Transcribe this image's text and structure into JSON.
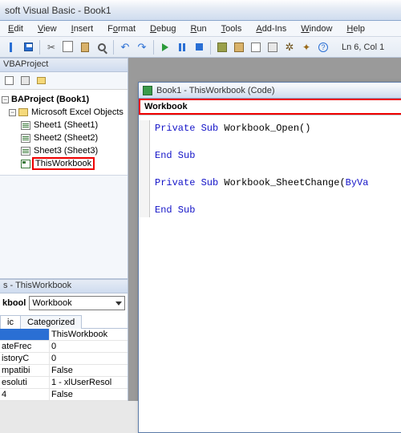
{
  "title": "soft Visual Basic - Book1",
  "menus": {
    "edit": "Edit",
    "view": "View",
    "insert": "Insert",
    "format": "Format",
    "debug": "Debug",
    "run": "Run",
    "tools": "Tools",
    "addins": "Add-Ins",
    "window": "Window",
    "help": "Help"
  },
  "cursor_pos": "Ln 6, Col 1",
  "project_explorer_title": "VBAProject",
  "tree": {
    "root": "BAProject (Book1)",
    "folder": "Microsoft Excel Objects",
    "items": [
      "Sheet1 (Sheet1)",
      "Sheet2 (Sheet2)",
      "Sheet3 (Sheet3)",
      "ThisWorkbook"
    ]
  },
  "props": {
    "title": "s - ThisWorkbook",
    "selector_name": "kbool",
    "selector_type": "Workbook",
    "tabs": {
      "alpha": "ic",
      "cat": "Categorized"
    },
    "rows": [
      {
        "name": "",
        "value": "ThisWorkbook",
        "sel": true
      },
      {
        "name": "ateFrec",
        "value": "0"
      },
      {
        "name": "istoryC",
        "value": "0"
      },
      {
        "name": "mpatibi",
        "value": "False"
      },
      {
        "name": "esoluti",
        "value": "1 - xlUserResol"
      },
      {
        "name": "4",
        "value": "False"
      }
    ]
  },
  "code_window": {
    "title": "Book1 - ThisWorkbook (Code)",
    "obj_dd": "Workbook",
    "code_lines": [
      {
        "t": "kw",
        "s": "Private Sub"
      },
      {
        "t": "p",
        "s": " Workbook_Open()"
      },
      "nl",
      "nl",
      {
        "t": "kw",
        "s": "End Sub"
      },
      "nl",
      "nl",
      {
        "t": "kw",
        "s": "Private Sub"
      },
      {
        "t": "p",
        "s": " Workbook_SheetChange("
      },
      {
        "t": "kw",
        "s": "ByVa"
      },
      "nl",
      "nl",
      {
        "t": "kw",
        "s": "End Sub"
      },
      "nl"
    ]
  }
}
